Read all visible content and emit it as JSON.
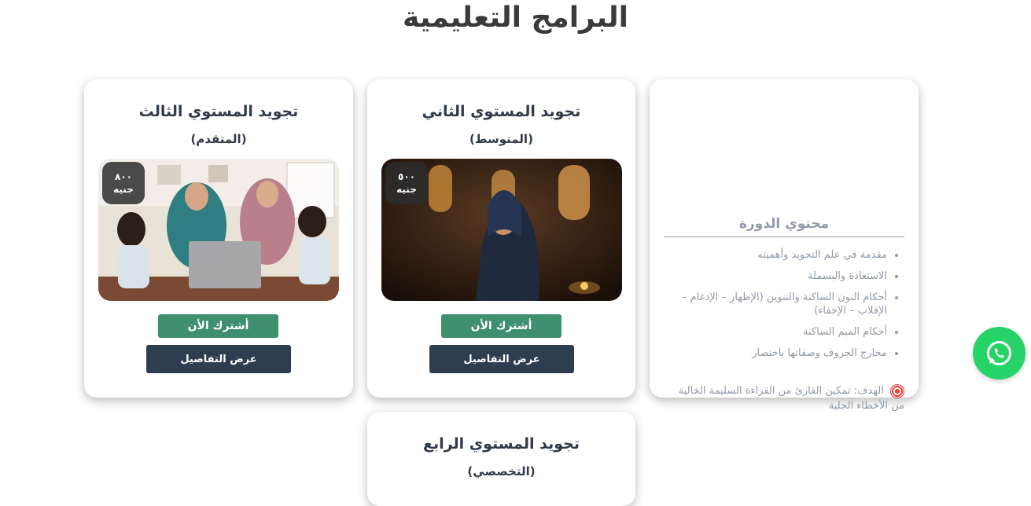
{
  "page": {
    "title": "البرامج التعليمية"
  },
  "content_card": {
    "heading": "محتوي الدورة",
    "items": [
      "مقدمة في علم التجويد وأهميته",
      "الاستعاذة والبسملة",
      "أحكام النون الساكنة والتنوين (الإظهار – الإدغام – الإقلاب – الإخفاء)",
      "أحكام الميم الساكنة",
      "مخارج الحروف وصفاتها باختصار"
    ],
    "goal": "الهدف: تمكين القارئ من القراءة السليمة الخالية من الأخطاء الجلية",
    "goal_icon": "target-icon"
  },
  "courses": [
    {
      "title": "تجويد المستوي الثاني",
      "level": "(المتوسط)",
      "price_value": "٥٠٠",
      "price_unit": "جنيه",
      "subscribe_label": "أشترك الأن",
      "details_label": "عرض التفاصيل"
    },
    {
      "title": "تجويد المستوي الثالث",
      "level": "(المتقدم)",
      "price_value": "٨٠٠",
      "price_unit": "جنيه",
      "subscribe_label": "أشترك الأن",
      "details_label": "عرض التفاصيل"
    },
    {
      "title": "تجويد المستوي الرابع",
      "level": "(التخصصي)"
    }
  ],
  "whatsapp": {
    "icon": "whatsapp-icon",
    "color": "#25d366"
  },
  "colors": {
    "subscribe": "#3d8f6d",
    "details": "#2f3d50",
    "muted": "#8f9aab",
    "title": "#3a3a3a"
  }
}
